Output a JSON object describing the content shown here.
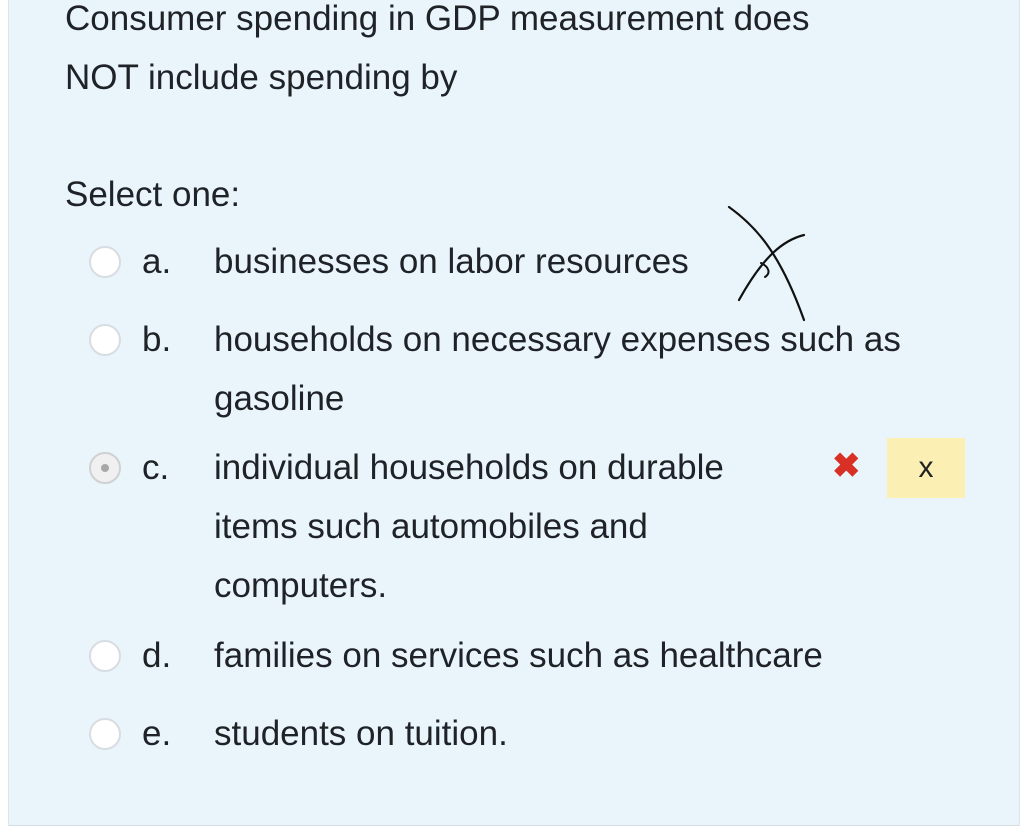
{
  "question": {
    "line1": "Consumer spending in GDP measurement does",
    "line2": "NOT include spending by",
    "prompt": "Select one:"
  },
  "options": [
    {
      "letter": "a.",
      "text": "businesses on labor resources",
      "selected": false
    },
    {
      "letter": "b.",
      "text": "households on necessary expenses such as gasoline",
      "selected": false
    },
    {
      "letter": "c.",
      "text": "individual households on durable items such automobiles and computers.",
      "selected": true
    },
    {
      "letter": "d.",
      "text": "families on services such as healthcare",
      "selected": false
    },
    {
      "letter": "e.",
      "text": "students on tuition.",
      "selected": false
    }
  ],
  "feedback": {
    "incorrect_icon": "cross-icon",
    "incorrect_color": "#d93025",
    "box_text": "x",
    "box_color": "#fcefb4"
  },
  "colors": {
    "panel_background": "#e9f5fb",
    "text": "#1f2226"
  }
}
